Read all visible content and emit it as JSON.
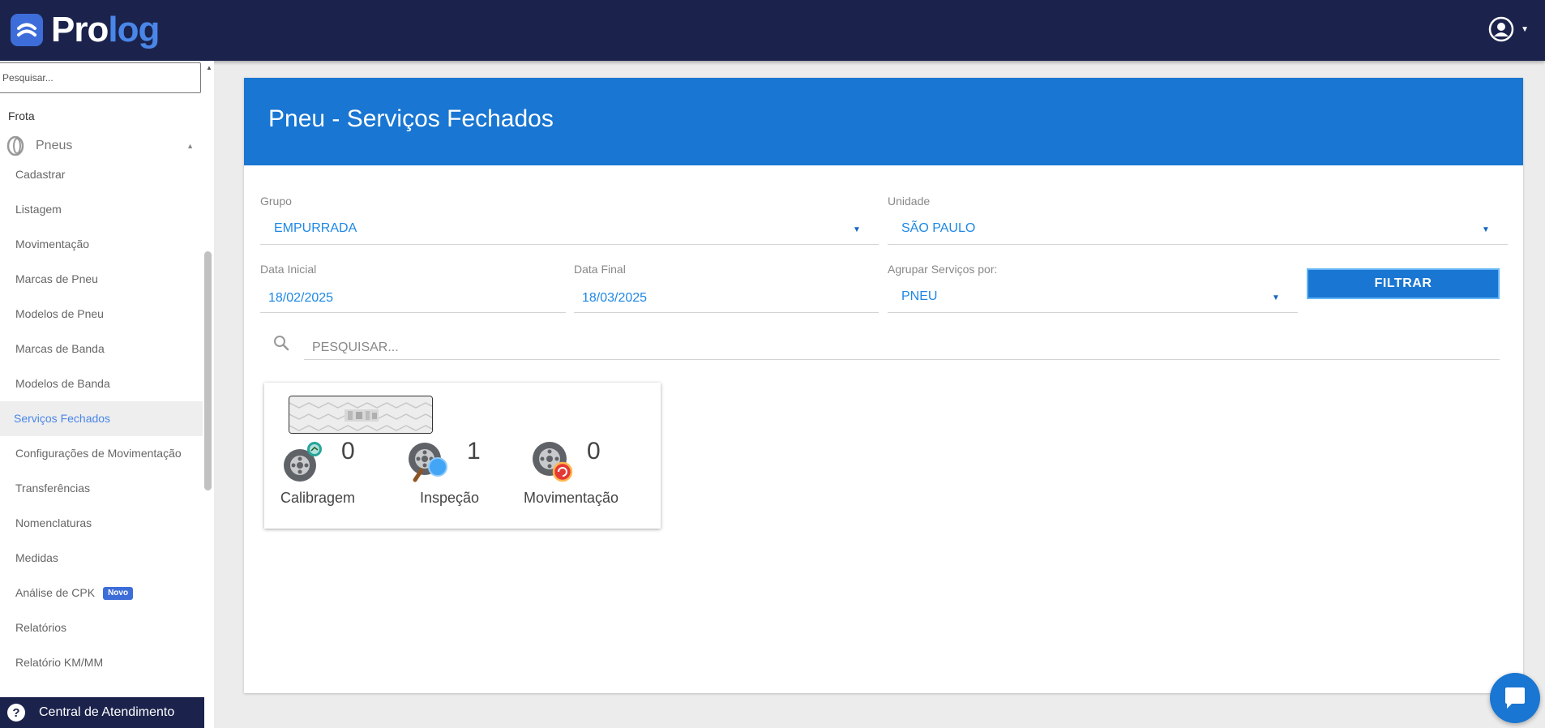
{
  "app": {
    "logo_pro": "Pro",
    "logo_log": "log"
  },
  "sidebar": {
    "search_placeholder": "Pesquisar...",
    "section": "Frota",
    "group": "Pneus",
    "items": [
      {
        "label": "Cadastrar"
      },
      {
        "label": "Listagem"
      },
      {
        "label": "Movimentação"
      },
      {
        "label": "Marcas de Pneu"
      },
      {
        "label": "Modelos de Pneu"
      },
      {
        "label": "Marcas de Banda"
      },
      {
        "label": "Modelos de Banda"
      },
      {
        "label": "Serviços Fechados"
      },
      {
        "label": "Configurações de Movimentação"
      },
      {
        "label": "Transferências"
      },
      {
        "label": "Nomenclaturas"
      },
      {
        "label": "Medidas"
      },
      {
        "label": "Análise de CPK",
        "badge": "Novo"
      },
      {
        "label": "Relatórios"
      },
      {
        "label": "Relatório KM/MM"
      }
    ],
    "help": "Central de Atendimento"
  },
  "page": {
    "title": "Pneu - Serviços Fechados",
    "grupo_label": "Grupo",
    "grupo_value": "EMPURRADA",
    "unidade_label": "Unidade",
    "unidade_value": "SÃO PAULO",
    "data_inicial_label": "Data Inicial",
    "data_inicial_value": "18/02/2025",
    "data_final_label": "Data Final",
    "data_final_value": "18/03/2025",
    "agrupar_label": "Agrupar Serviços por:",
    "agrupar_value": "PNEU",
    "filter_button": "FILTRAR",
    "search_placeholder": "PESQUISAR..."
  },
  "result_card": {
    "stats": [
      {
        "label": "Calibragem",
        "count": "0"
      },
      {
        "label": "Inspeção",
        "count": "1"
      },
      {
        "label": "Movimentação",
        "count": "0"
      }
    ]
  },
  "colors": {
    "topbar": "#1b234d",
    "header_blue": "#1976d2",
    "accent": "#1e88e5"
  }
}
